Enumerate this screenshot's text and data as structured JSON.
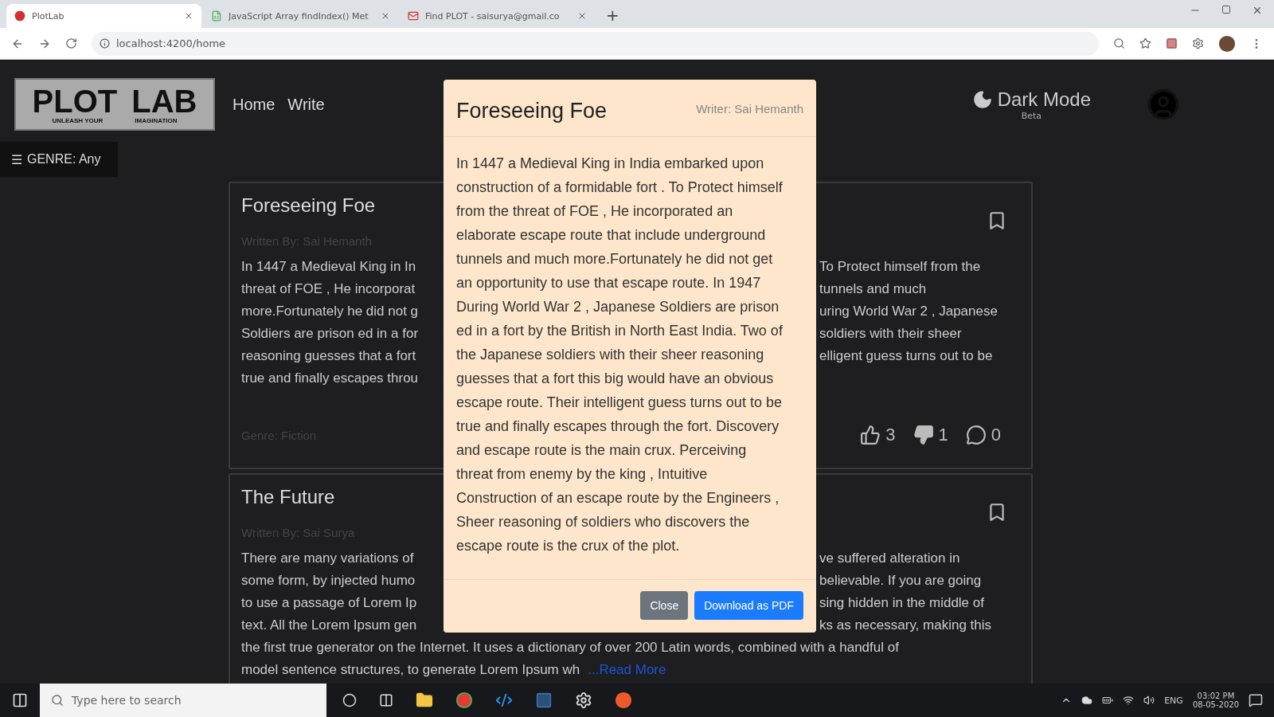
{
  "browser": {
    "tabs": [
      {
        "title": "PlotLab",
        "selected": true,
        "kind": "angular"
      },
      {
        "title": "JavaScript Array findIndex() Met",
        "selected": false,
        "kind": "sheet"
      },
      {
        "title": "Find PLOT - saisurya@gmail.co",
        "selected": false,
        "kind": "mail"
      }
    ],
    "new_tab": "+",
    "address": "localhost:4200/home"
  },
  "header": {
    "logo": {
      "main_left": "PLOT",
      "main_right": "LAB",
      "tag_left": "UNLEASH YOUR",
      "tag_right": "IMAGINATION"
    },
    "nav": [
      "Home",
      "Write"
    ],
    "theme_toggle": {
      "label": "Dark Mode",
      "badge": "Beta"
    }
  },
  "genre_button": {
    "icon": "☰",
    "label": "GENRE: Any"
  },
  "cards": [
    {
      "title": "Foreseeing Foe",
      "author": "Written By: Sai Hemanth",
      "lines": [
        {
          "kind": "split",
          "left": "In 1447 a Medieval King in In",
          "right": "To Protect himself from the"
        },
        {
          "kind": "split",
          "left": "threat of FOE , He incorporat",
          "right": "tunnels and much"
        },
        {
          "kind": "split",
          "left": "more.Fortunately he did not g",
          "right": "uring World War 2 , Japanese"
        },
        {
          "kind": "split",
          "left": "Soldiers are prison ed in a for",
          "right": "soldiers with their sheer"
        },
        {
          "kind": "split",
          "left": "reasoning guesses that a fort",
          "right": "elligent guess turns out to be"
        },
        {
          "kind": "split",
          "left": "true and finally escapes throu"
        }
      ],
      "genre": "Genre: Fiction",
      "stats": [
        {
          "kind": "like",
          "count": "3"
        },
        {
          "kind": "dislike",
          "count": "1"
        },
        {
          "kind": "comment",
          "count": "0"
        }
      ]
    },
    {
      "title": "The Future",
      "author": "Written By: Sai Surya",
      "lines": [
        {
          "kind": "split",
          "left": "There are many variations of",
          "right": "ve suffered alteration in"
        },
        {
          "kind": "split",
          "left": "some form, by injected humo",
          "right": "believable. If you are going"
        },
        {
          "kind": "split",
          "left": "to use a passage of Lorem Ip",
          "right": "sing hidden in the middle of"
        },
        {
          "kind": "split",
          "left": "text. All the Lorem Ipsum gen",
          "right": "ks as necessary, making this"
        },
        {
          "kind": "full",
          "left": "the first true generator on the Internet. It uses a dictionary of over 200 Latin words, combined with a handful of"
        },
        {
          "kind": "full",
          "left": "model sentence structures, to generate Lorem Ipsum wh",
          "link": "...Read More"
        }
      ]
    }
  ],
  "modal": {
    "title": "Foreseeing Foe",
    "writer": "Writer: Sai Hemanth",
    "body": "In 1447 a Medieval King in India embarked upon construction of a formidable fort . To Protect himself from the threat of FOE , He incorporated an elaborate escape route that include underground tunnels and much more.Fortunately he did not get an opportunity to use that escape route. In 1947 During World War 2 , Japanese Soldiers are prison ed in a fort by the British in North East India. Two of the Japanese soldiers with their sheer reasoning guesses that a fort this big would have an obvious escape route. Their intelligent guess turns out to be true and finally escapes through the fort. Discovery and escape route is the main crux. Perceiving threat from enemy by the king , Intuitive Construction of an escape route by the Engineers , Sheer reasoning of soldiers who discovers the escape route is the crux of the plot.",
    "buttons": [
      {
        "label": "Close",
        "kind": "secondary"
      },
      {
        "label": "Download as PDF",
        "kind": "primary"
      }
    ]
  },
  "taskbar": {
    "search_placeholder": "Type here to search",
    "language": "ENG",
    "time": "03:02 PM",
    "date": "08-05-2020"
  }
}
